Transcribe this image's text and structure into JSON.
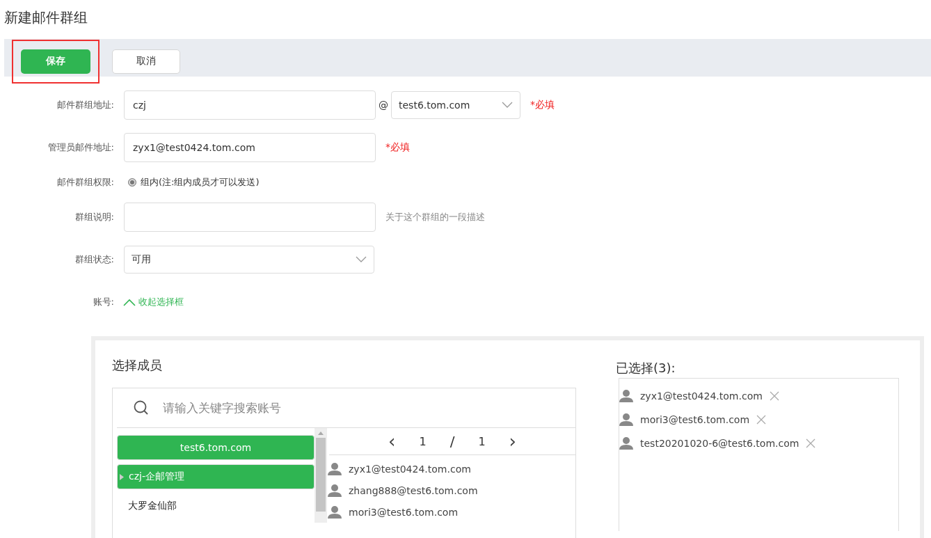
{
  "page": {
    "title": "新建邮件群组"
  },
  "toolbar": {
    "buttons": [
      {
        "label": "保存",
        "kind": "primary",
        "highlighted": true
      },
      {
        "label": "取消",
        "kind": "default",
        "highlighted": false
      }
    ]
  },
  "form": {
    "rows": [
      {
        "kind": "address",
        "label": "邮件群组地址:",
        "value": "czj",
        "at": "@",
        "domain": "test6.tom.com",
        "required_note": "*必填"
      },
      {
        "kind": "text",
        "label": "管理员邮件地址:",
        "value": "zyx1@test0424.tom.com",
        "required_note": "*必填"
      },
      {
        "kind": "radio",
        "label": "邮件群组权限:",
        "option": "组内(注:组内成员才可以发送)",
        "selected": true
      },
      {
        "kind": "text",
        "label": "群组说明:",
        "value": "",
        "hint": "关于这个群组的一段描述"
      },
      {
        "kind": "select",
        "label": "群组状态:",
        "value": "可用"
      },
      {
        "kind": "toggle",
        "label": "账号:",
        "link": "收起选择框",
        "expanded": true
      }
    ]
  },
  "member_picker": {
    "title": "选择成员",
    "search": {
      "placeholder": "请输入关键字搜索账号"
    },
    "tree": [
      {
        "label": "test6.tom.com",
        "selected": true,
        "children": [
          {
            "label": "czj-企邮管理",
            "selected": true
          },
          {
            "label": "大罗金仙部",
            "selected": false
          }
        ]
      }
    ],
    "pager": {
      "prev": "‹",
      "page": "1",
      "sep": "/",
      "total": "1",
      "next": "›"
    },
    "members": [
      "zyx1@test0424.tom.com",
      "zhang888@test6.tom.com",
      "mori3@test6.tom.com"
    ]
  },
  "selected_panel": {
    "title": "已选择(3):",
    "items": [
      "zyx1@test0424.tom.com",
      "mori3@test6.tom.com",
      "test20201020-6@test6.tom.com"
    ]
  }
}
